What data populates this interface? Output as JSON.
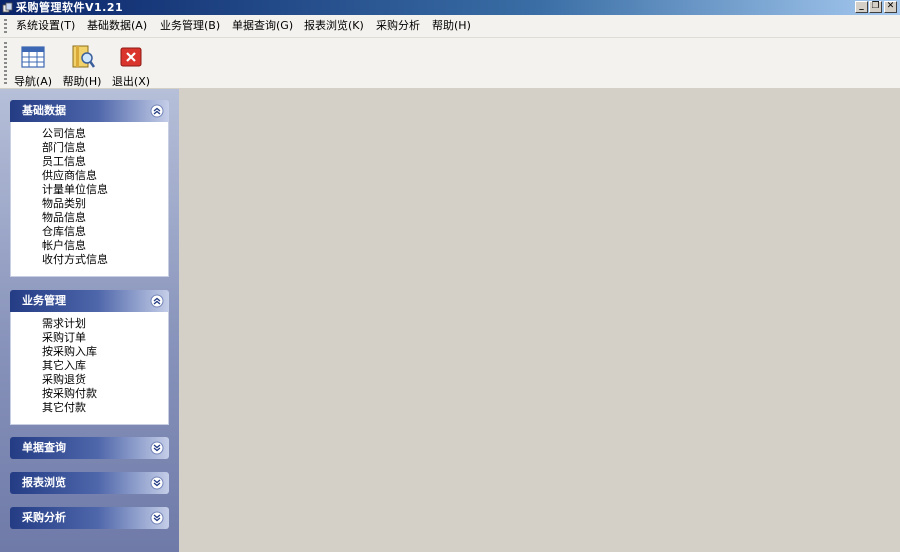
{
  "window": {
    "title": "采购管理软件V1.21"
  },
  "menu": [
    {
      "label": "系统设置(T)"
    },
    {
      "label": "基础数据(A)"
    },
    {
      "label": "业务管理(B)"
    },
    {
      "label": "单据查询(G)"
    },
    {
      "label": "报表浏览(K)"
    },
    {
      "label": "采购分析"
    },
    {
      "label": "帮助(H)"
    }
  ],
  "toolbar": {
    "nav_label": "导航(A)",
    "help_label": "帮助(H)",
    "exit_label": "退出(X)"
  },
  "sidebar": {
    "groups": [
      {
        "title": "基础数据",
        "expanded": true,
        "items": [
          "公司信息",
          "部门信息",
          "员工信息",
          "供应商信息",
          "计量单位信息",
          "物品类别",
          "物品信息",
          "仓库信息",
          "帐户信息",
          "收付方式信息"
        ]
      },
      {
        "title": "业务管理",
        "expanded": true,
        "items": [
          "需求计划",
          "采购订单",
          "按采购入库",
          "其它入库",
          "采购退货",
          "按采购付款",
          "其它付款"
        ]
      },
      {
        "title": "单据查询",
        "expanded": false,
        "items": []
      },
      {
        "title": "报表浏览",
        "expanded": false,
        "items": []
      },
      {
        "title": "采购分析",
        "expanded": false,
        "items": []
      }
    ]
  },
  "colors": {
    "sidebar_header": "#233c84",
    "workspace": "#d4d0c8",
    "exit_button": "#d9352c"
  }
}
